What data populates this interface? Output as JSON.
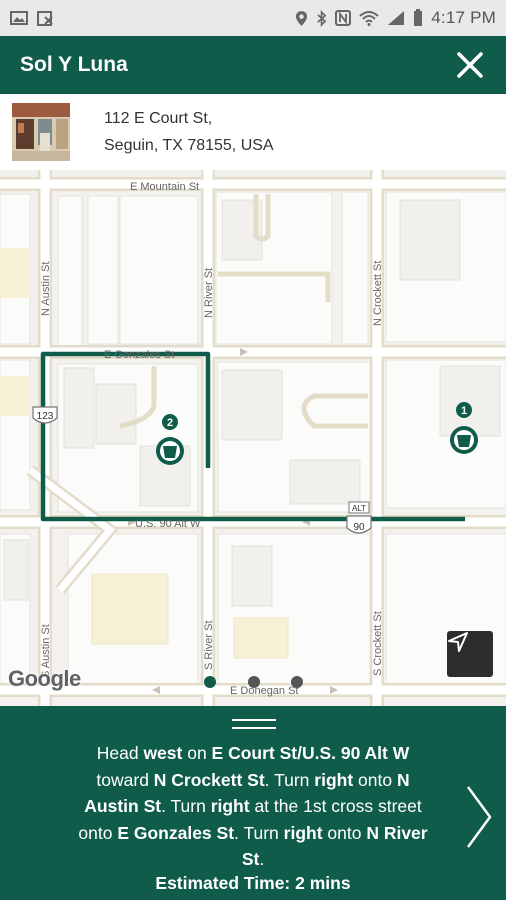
{
  "status_bar": {
    "time": "4:17 PM"
  },
  "header": {
    "title": "Sol Y Luna"
  },
  "address": {
    "line1": "112 E Court St,",
    "line2": "Seguin, TX 78155, USA"
  },
  "map": {
    "streets": {
      "e_mountain": "E Mountain St",
      "n_austin": "N Austin St",
      "n_river": "N River St",
      "n_crockett": "N Crockett St",
      "e_gonzales": "E Gonzales St",
      "us90": "U.S. 90 Alt W",
      "s_austin": "S Austin St",
      "s_river": "S River St",
      "s_crockett": "S Crockett St",
      "e_donegan": "E Donegan St"
    },
    "shields": {
      "route_123": "123",
      "alt": "ALT",
      "route_90": "90"
    },
    "markers": [
      {
        "label": "1"
      },
      {
        "label": "2"
      }
    ],
    "attribution": "Google",
    "route_color": "#0f5c4a"
  },
  "directions": {
    "t1": "Head ",
    "b1": "west",
    "t2": " on ",
    "b2": "E Court St/U.S. 90 Alt W",
    "t3": " toward ",
    "b3": "N Crockett St",
    "t4": ". Turn ",
    "b4": "right",
    "t5": " onto ",
    "b5": "N Austin St",
    "t6": ". Turn ",
    "b6": "right",
    "t7": " at the 1st cross street onto ",
    "b7": "E Gonzales St",
    "t8": ". Turn ",
    "b8": "right",
    "t9": " onto ",
    "b9": "N River St",
    "t10": ".",
    "eta": "Estimated Time: 2 mins"
  },
  "colors": {
    "header": "#0f5c4a",
    "status_bar": "#e9e9e9"
  }
}
